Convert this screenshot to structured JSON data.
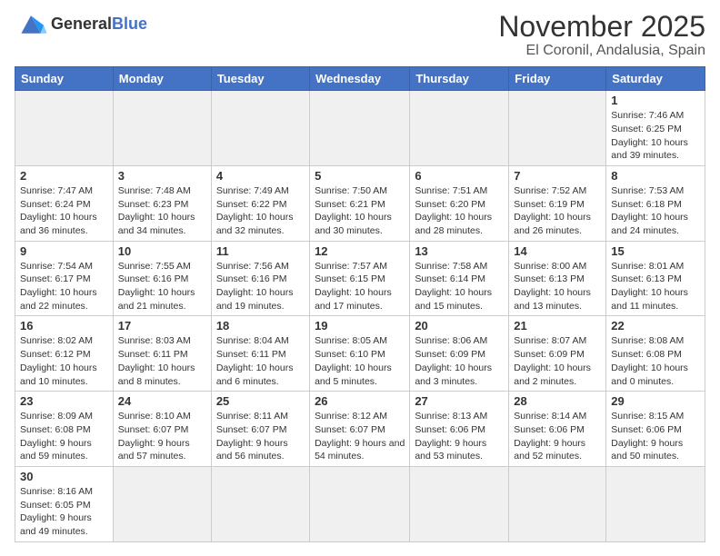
{
  "header": {
    "logo_general": "General",
    "logo_blue": "Blue",
    "month_title": "November 2025",
    "location": "El Coronil, Andalusia, Spain"
  },
  "days_of_week": [
    "Sunday",
    "Monday",
    "Tuesday",
    "Wednesday",
    "Thursday",
    "Friday",
    "Saturday"
  ],
  "weeks": [
    [
      {
        "num": "",
        "info": ""
      },
      {
        "num": "",
        "info": ""
      },
      {
        "num": "",
        "info": ""
      },
      {
        "num": "",
        "info": ""
      },
      {
        "num": "",
        "info": ""
      },
      {
        "num": "",
        "info": ""
      },
      {
        "num": "1",
        "info": "Sunrise: 7:46 AM\nSunset: 6:25 PM\nDaylight: 10 hours and 39 minutes."
      }
    ],
    [
      {
        "num": "2",
        "info": "Sunrise: 7:47 AM\nSunset: 6:24 PM\nDaylight: 10 hours and 36 minutes."
      },
      {
        "num": "3",
        "info": "Sunrise: 7:48 AM\nSunset: 6:23 PM\nDaylight: 10 hours and 34 minutes."
      },
      {
        "num": "4",
        "info": "Sunrise: 7:49 AM\nSunset: 6:22 PM\nDaylight: 10 hours and 32 minutes."
      },
      {
        "num": "5",
        "info": "Sunrise: 7:50 AM\nSunset: 6:21 PM\nDaylight: 10 hours and 30 minutes."
      },
      {
        "num": "6",
        "info": "Sunrise: 7:51 AM\nSunset: 6:20 PM\nDaylight: 10 hours and 28 minutes."
      },
      {
        "num": "7",
        "info": "Sunrise: 7:52 AM\nSunset: 6:19 PM\nDaylight: 10 hours and 26 minutes."
      },
      {
        "num": "8",
        "info": "Sunrise: 7:53 AM\nSunset: 6:18 PM\nDaylight: 10 hours and 24 minutes."
      }
    ],
    [
      {
        "num": "9",
        "info": "Sunrise: 7:54 AM\nSunset: 6:17 PM\nDaylight: 10 hours and 22 minutes."
      },
      {
        "num": "10",
        "info": "Sunrise: 7:55 AM\nSunset: 6:16 PM\nDaylight: 10 hours and 21 minutes."
      },
      {
        "num": "11",
        "info": "Sunrise: 7:56 AM\nSunset: 6:16 PM\nDaylight: 10 hours and 19 minutes."
      },
      {
        "num": "12",
        "info": "Sunrise: 7:57 AM\nSunset: 6:15 PM\nDaylight: 10 hours and 17 minutes."
      },
      {
        "num": "13",
        "info": "Sunrise: 7:58 AM\nSunset: 6:14 PM\nDaylight: 10 hours and 15 minutes."
      },
      {
        "num": "14",
        "info": "Sunrise: 8:00 AM\nSunset: 6:13 PM\nDaylight: 10 hours and 13 minutes."
      },
      {
        "num": "15",
        "info": "Sunrise: 8:01 AM\nSunset: 6:13 PM\nDaylight: 10 hours and 11 minutes."
      }
    ],
    [
      {
        "num": "16",
        "info": "Sunrise: 8:02 AM\nSunset: 6:12 PM\nDaylight: 10 hours and 10 minutes."
      },
      {
        "num": "17",
        "info": "Sunrise: 8:03 AM\nSunset: 6:11 PM\nDaylight: 10 hours and 8 minutes."
      },
      {
        "num": "18",
        "info": "Sunrise: 8:04 AM\nSunset: 6:11 PM\nDaylight: 10 hours and 6 minutes."
      },
      {
        "num": "19",
        "info": "Sunrise: 8:05 AM\nSunset: 6:10 PM\nDaylight: 10 hours and 5 minutes."
      },
      {
        "num": "20",
        "info": "Sunrise: 8:06 AM\nSunset: 6:09 PM\nDaylight: 10 hours and 3 minutes."
      },
      {
        "num": "21",
        "info": "Sunrise: 8:07 AM\nSunset: 6:09 PM\nDaylight: 10 hours and 2 minutes."
      },
      {
        "num": "22",
        "info": "Sunrise: 8:08 AM\nSunset: 6:08 PM\nDaylight: 10 hours and 0 minutes."
      }
    ],
    [
      {
        "num": "23",
        "info": "Sunrise: 8:09 AM\nSunset: 6:08 PM\nDaylight: 9 hours and 59 minutes."
      },
      {
        "num": "24",
        "info": "Sunrise: 8:10 AM\nSunset: 6:07 PM\nDaylight: 9 hours and 57 minutes."
      },
      {
        "num": "25",
        "info": "Sunrise: 8:11 AM\nSunset: 6:07 PM\nDaylight: 9 hours and 56 minutes."
      },
      {
        "num": "26",
        "info": "Sunrise: 8:12 AM\nSunset: 6:07 PM\nDaylight: 9 hours and 54 minutes."
      },
      {
        "num": "27",
        "info": "Sunrise: 8:13 AM\nSunset: 6:06 PM\nDaylight: 9 hours and 53 minutes."
      },
      {
        "num": "28",
        "info": "Sunrise: 8:14 AM\nSunset: 6:06 PM\nDaylight: 9 hours and 52 minutes."
      },
      {
        "num": "29",
        "info": "Sunrise: 8:15 AM\nSunset: 6:06 PM\nDaylight: 9 hours and 50 minutes."
      }
    ],
    [
      {
        "num": "30",
        "info": "Sunrise: 8:16 AM\nSunset: 6:05 PM\nDaylight: 9 hours and 49 minutes."
      },
      {
        "num": "",
        "info": ""
      },
      {
        "num": "",
        "info": ""
      },
      {
        "num": "",
        "info": ""
      },
      {
        "num": "",
        "info": ""
      },
      {
        "num": "",
        "info": ""
      },
      {
        "num": "",
        "info": ""
      }
    ]
  ]
}
